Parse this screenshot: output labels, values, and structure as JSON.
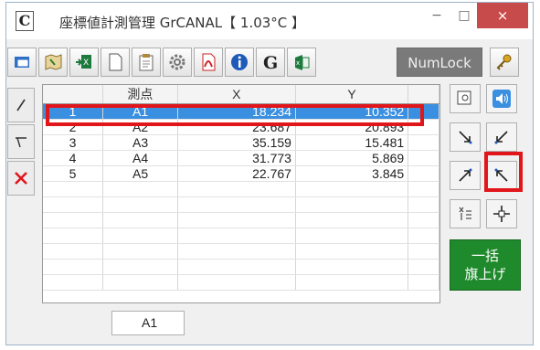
{
  "window": {
    "app_icon": "C",
    "title": "座標値計測管理 GrCANAL【 1.03°C 】",
    "minimize_label": "−",
    "maximize_label": "□",
    "close_label": "×"
  },
  "toolbar": {
    "buttons": [
      "window-icon",
      "map-icon",
      "excel-import-icon",
      "blank-page-icon",
      "report-icon",
      "settings-icon",
      "pdf-icon",
      "info-icon",
      "google-icon",
      "excel-icon"
    ],
    "numlock_label": "NumLock",
    "key_icon": "key-icon"
  },
  "left_tools": [
    "line-tool-icon",
    "angle-tool-icon",
    "delete-icon"
  ],
  "grid": {
    "columns": [
      "",
      "測点",
      "X",
      "Y",
      ""
    ],
    "rows": [
      {
        "no": "1",
        "name": "A1",
        "x": "18.234",
        "y": "10.352",
        "selected": true
      },
      {
        "no": "2",
        "name": "A2",
        "x": "23.687",
        "y": "20.893",
        "selected": false
      },
      {
        "no": "3",
        "name": "A3",
        "x": "35.159",
        "y": "15.481",
        "selected": false
      },
      {
        "no": "4",
        "name": "A4",
        "x": "31.773",
        "y": "5.869",
        "selected": false
      },
      {
        "no": "5",
        "name": "A5",
        "x": "22.767",
        "y": "3.845",
        "selected": false
      }
    ]
  },
  "current_cell": "A1",
  "right_tools": [
    "point-search-icon",
    "sound-icon",
    "arrow-down-right-icon",
    "arrow-down-left-icon",
    "arrow-up-right-icon",
    "arrow-up-left-icon",
    "flip-icon",
    "move-cross-icon"
  ],
  "flag_button": {
    "line1": "一括",
    "line2": "旗上げ"
  }
}
